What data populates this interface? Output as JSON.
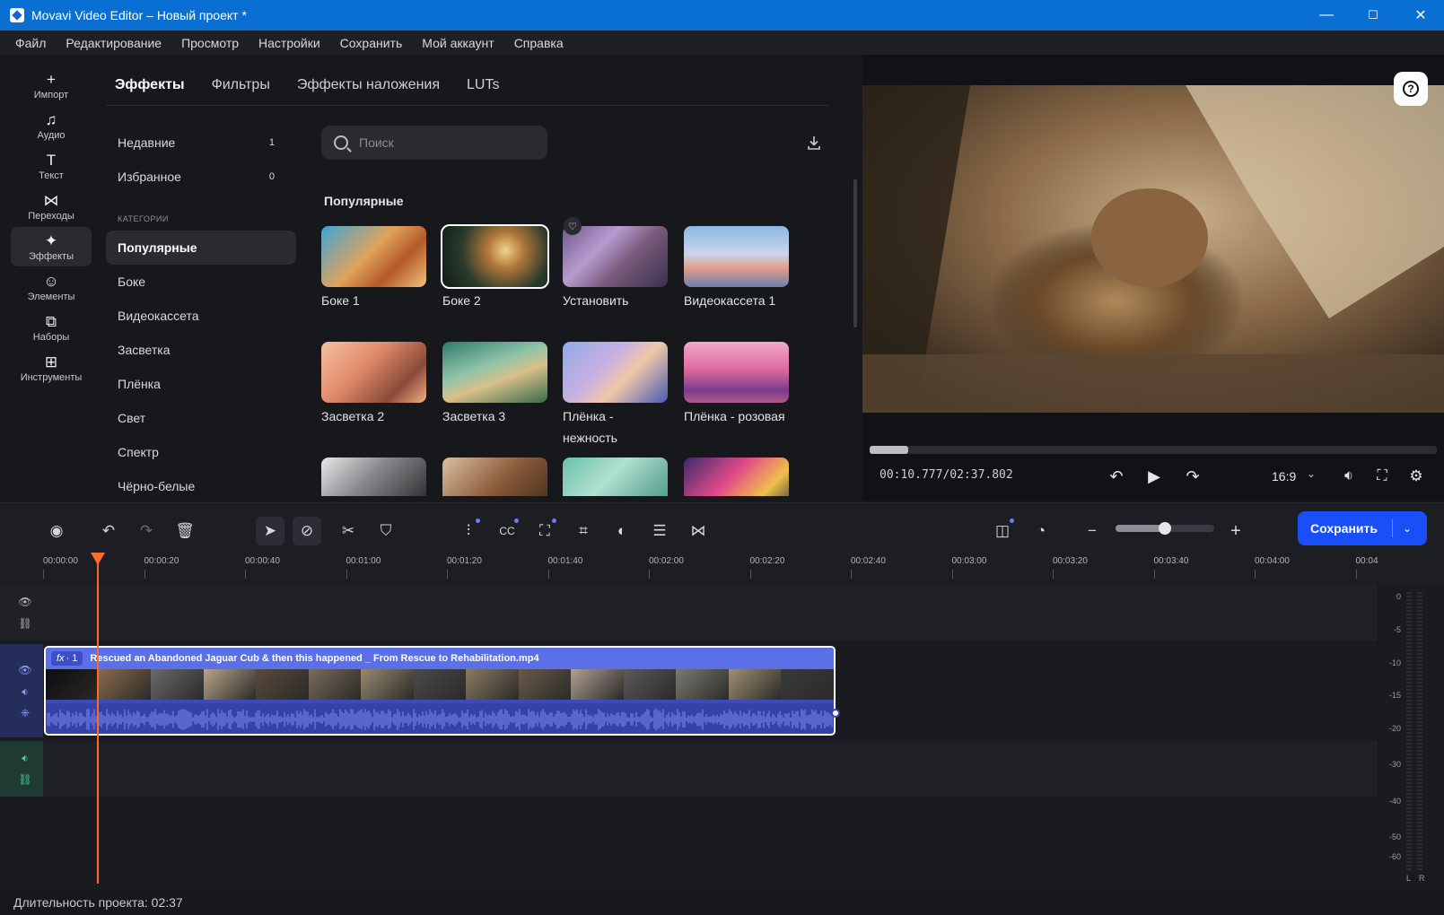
{
  "window": {
    "title": "Movavi Video Editor – Новый проект *",
    "minimize": "—",
    "maximize": "☐",
    "close": "✕"
  },
  "menu": [
    "Файл",
    "Редактирование",
    "Просмотр",
    "Настройки",
    "Сохранить",
    "Мой аккаунт",
    "Справка"
  ],
  "sidebar": [
    {
      "label": "Импорт",
      "icon": "plus-icon",
      "glyph": "+"
    },
    {
      "label": "Аудио",
      "icon": "music-note-icon",
      "glyph": "♫"
    },
    {
      "label": "Текст",
      "icon": "text-icon",
      "glyph": "T"
    },
    {
      "label": "Переходы",
      "icon": "transition-icon",
      "glyph": "⋈"
    },
    {
      "label": "Эффекты",
      "icon": "effects-icon",
      "glyph": "✦",
      "active": true
    },
    {
      "label": "Элементы",
      "icon": "smiley-icon",
      "glyph": "☺"
    },
    {
      "label": "Наборы",
      "icon": "bag-icon",
      "glyph": "⧉"
    },
    {
      "label": "Инструменты",
      "icon": "grid-icon",
      "glyph": "⊞"
    }
  ],
  "tabs": [
    "Эффекты",
    "Фильтры",
    "Эффекты наложения",
    "LUTs"
  ],
  "categories": {
    "recent": {
      "label": "Недавние",
      "count": "1"
    },
    "favorites": {
      "label": "Избранное",
      "count": "0"
    },
    "heading": "КАТЕГОРИИ",
    "items": [
      "Популярные",
      "Боке",
      "Видеокассета",
      "Засветка",
      "Плёнка",
      "Свет",
      "Спектр",
      "Чёрно-белые"
    ]
  },
  "search": {
    "placeholder": "Поиск",
    "value": ""
  },
  "section_title": "Популярные",
  "effects": [
    {
      "label": "Боке 1",
      "bg": "linear-gradient(135deg,#3fa4d8 0%,#e0a35a 45%,#b45a2a 70%,#f2c27a 100%)"
    },
    {
      "label": "Боке 2",
      "bg": "radial-gradient(circle at 60% 40%,#f0d38a 0%,#b0763a 25%,#2a3b2c 60%,#0f1a14 100%)"
    },
    {
      "label": "Установить",
      "bg": "linear-gradient(135deg,#6d5a8a 0%,#b89ad0 35%,#7a5a7a 60%,#3a3050 100%)"
    },
    {
      "label": "Видеокассета 1",
      "bg": "linear-gradient(180deg,#8db7e0 0%,#c9d6ec 45%,#e09a8a 70%,#6a7fb0 100%)"
    },
    {
      "label": "Засветка 2",
      "bg": "linear-gradient(135deg,#f6c1a0 0%,#e08a6a 40%,#8a4a3a 75%,#f0b080 100%)"
    },
    {
      "label": "Засветка 3",
      "bg": "linear-gradient(160deg,#2f7a6a 0%,#8fc4a8 40%,#d9c08a 60%,#3a6a4a 100%)"
    },
    {
      "label": "Плёнка - нежность",
      "bg": "linear-gradient(135deg,#8fa8e8 0%,#c9b0e0 40%,#f0c8a8 60%,#4a5ab0 100%)"
    },
    {
      "label": "Плёнка - розовая",
      "bg": "linear-gradient(180deg,#f0a8c8 0%,#e06aa0 45%,#7a3a8a 80%,#b05a90 100%)"
    }
  ],
  "effects_row3": [
    {
      "bg": "linear-gradient(135deg,#e8e8ea 0%,#8a8a8e 40%,#1a1a1c 100%)"
    },
    {
      "bg": "linear-gradient(135deg,#d8c0a0 0%,#8a5a3a 50%,#3a2a1a 100%)"
    },
    {
      "bg": "linear-gradient(135deg,#6ac0a8 0%,#b0e0d0 40%,#3a8a7a 100%)"
    },
    {
      "bg": "linear-gradient(135deg,#3a2a6a 0%,#e04a8a 40%,#f0c04a 70%,#1a1a3a 100%)"
    }
  ],
  "preview": {
    "timecode": "00:10.777/02:37.802",
    "progress": 0.068,
    "aspect_ratio": "16:9"
  },
  "toolbar": {
    "save_label": "Сохранить",
    "zoom_level": 0.5
  },
  "ruler": [
    "00:00:00",
    "00:00:20",
    "00:00:40",
    "00:01:00",
    "00:01:20",
    "00:01:40",
    "00:02:00",
    "00:02:20",
    "00:02:40",
    "00:03:00",
    "00:03:20",
    "00:03:40",
    "00:04:00",
    "00:04"
  ],
  "clip": {
    "fx_badge": "fx",
    "fx_count": "· 1",
    "filename": "Rescued an Abandoned Jaguar Cub & then this happened _ From Rescue to Rehabilitation.mp4"
  },
  "meter": {
    "labels": [
      "0",
      "-5",
      "-10",
      "-15",
      "-20",
      "-30",
      "-40",
      "-50",
      "-60"
    ],
    "channels": [
      "L",
      "R"
    ]
  },
  "status": {
    "duration": "Длительность проекта: 02:37"
  },
  "colors": {
    "accent": "#1a4ff7",
    "titlebar": "#0a6fd2",
    "playhead": "#ff6a2b",
    "clip": "#5b6fe6"
  }
}
